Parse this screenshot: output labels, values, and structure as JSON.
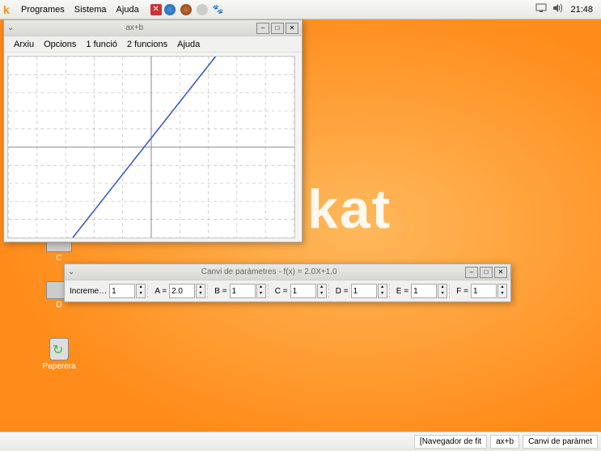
{
  "panel": {
    "menus": [
      "Programes",
      "Sistema",
      "Ajuda"
    ],
    "clock": "21:48"
  },
  "taskbar": {
    "items": [
      "[Navegador de fit",
      "ax+b",
      "Canvi de paràmet"
    ]
  },
  "desktop": {
    "icons": {
      "c": "C",
      "d": "D",
      "trash": "Paperera"
    }
  },
  "plot_window": {
    "title": "ax+b",
    "menus": [
      "Arxiu",
      "Opcions",
      "1 funció",
      "2 funcions",
      "Ajuda"
    ]
  },
  "param_window": {
    "title": "Canvi de paràmetres - f(x) = 2.0X+1.0",
    "increment_label": "Increme…",
    "increment_value": "1",
    "labels": {
      "a": "A =",
      "b": "B =",
      "c": "C =",
      "d": "D =",
      "e": "E =",
      "f": "F ="
    },
    "values": {
      "a": "2.0",
      "b": "1",
      "c": "1",
      "d": "1",
      "e": "1",
      "f": "1"
    }
  },
  "chart_data": {
    "type": "line",
    "title": "",
    "xlabel": "",
    "ylabel": "",
    "xlim": [
      -10,
      10
    ],
    "ylim": [
      -10,
      10
    ],
    "grid_step": 2,
    "series": [
      {
        "name": "f(x) = 2.0x + 1.0",
        "slope": 2.0,
        "intercept": 1.0,
        "color": "#3050d0",
        "x": [
          -5.5,
          4.5
        ],
        "y": [
          -10,
          10
        ]
      }
    ]
  }
}
